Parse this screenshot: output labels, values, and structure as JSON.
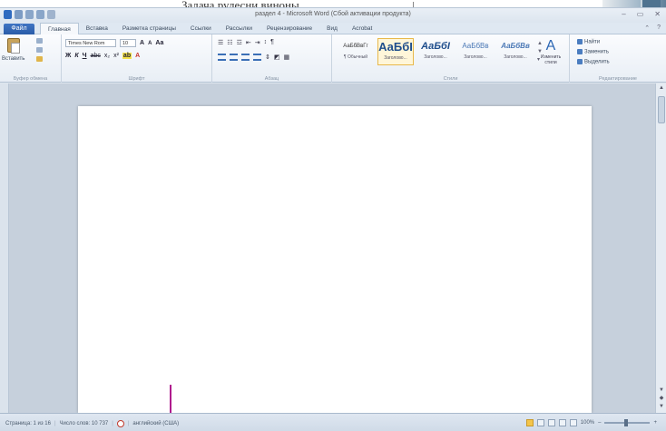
{
  "caption": "Задача рулесни виноны",
  "window": {
    "title": "раздел 4 - Microsoft Word (Сбой активации продукта)",
    "controls": {
      "minimize": "–",
      "maximize": "▭",
      "close": "✕"
    }
  },
  "tabs": {
    "file": "Файл",
    "items": [
      {
        "label": "Главная",
        "active": true
      },
      {
        "label": "Вставка",
        "active": false
      },
      {
        "label": "Разметка страницы",
        "active": false
      },
      {
        "label": "Ссылки",
        "active": false
      },
      {
        "label": "Рассылки",
        "active": false
      },
      {
        "label": "Рецензирование",
        "active": false
      },
      {
        "label": "Вид",
        "active": false
      },
      {
        "label": "Acrobat",
        "active": false
      }
    ],
    "right_help": "?",
    "right_minimize": "⌃"
  },
  "ribbon": {
    "clipboard": {
      "paste_label": "Вставить",
      "group_label": "Буфер обмена"
    },
    "font": {
      "font_name": "Times New Rom",
      "font_size": "10",
      "grow": "A",
      "shrink": "A",
      "case": "Aa",
      "bold": "Ж",
      "italic": "К",
      "underline": "Ч",
      "strike": "abc",
      "subscript": "x₂",
      "superscript": "x²",
      "font_color": "A",
      "group_label": "Шрифт"
    },
    "paragraph": {
      "group_label": "Абзац",
      "pilcrow": "¶"
    },
    "styles": {
      "items": [
        {
          "sample": "АаБбВвГг",
          "name": "¶ Обычный"
        },
        {
          "sample": "АаБбI",
          "name": "Заголово..."
        },
        {
          "sample": "АаБбI",
          "name": "Заголово..."
        },
        {
          "sample": "АаБбВв",
          "name": "Заголово..."
        },
        {
          "sample": "АаБбВв",
          "name": "Заголово..."
        }
      ],
      "change_styles_label": "Изменить стили",
      "group_label": "Стили"
    },
    "editing": {
      "find": "Найти",
      "replace": "Заменить",
      "select": "Выделить",
      "group_label": "Редактирование"
    }
  },
  "status": {
    "page": "Страница: 1 из 16",
    "words": "Число слов: 10 737",
    "language": "английский (США)",
    "zoom": "100%",
    "zoom_minus": "–",
    "zoom_plus": "+"
  },
  "colors": {
    "file_tab": "#2a5ca8",
    "accent_cursor": "#b01a8e",
    "style_highlight": "#e8b84a"
  }
}
